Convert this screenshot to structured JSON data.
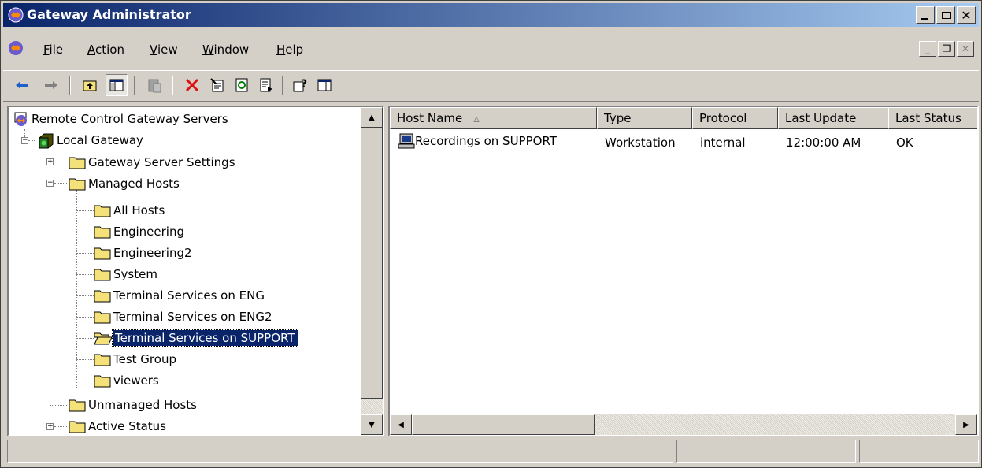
{
  "window": {
    "title": "Gateway Administrator"
  },
  "menu": {
    "items": [
      {
        "label": "File"
      },
      {
        "label": "Action"
      },
      {
        "label": "View"
      },
      {
        "label": "Window"
      },
      {
        "label": "Help"
      }
    ]
  },
  "tree": {
    "root": "Remote Control Gateway Servers",
    "gateway": "Local Gateway",
    "settings": "Gateway Server Settings",
    "managed": "Managed Hosts",
    "groups": [
      "All Hosts",
      "Engineering",
      "Engineering2",
      "System",
      "Terminal Services on ENG",
      "Terminal Services on ENG2",
      "Terminal Services on SUPPORT",
      "Test Group",
      "viewers"
    ],
    "selected_group": "Terminal Services on SUPPORT",
    "unmanaged": "Unmanaged Hosts",
    "active": "Active Status"
  },
  "list": {
    "columns": [
      "Host Name",
      "Type",
      "Protocol",
      "Last Update",
      "Last Status"
    ],
    "sort_indicator": "▵",
    "rows": [
      {
        "host": "Recordings on SUPPORT",
        "type": "Workstation",
        "protocol": "internal",
        "last_update": "12:00:00 AM",
        "last_status": "OK"
      }
    ]
  },
  "colors": {
    "title_start": "#0a246a",
    "title_end": "#a6caf0",
    "selection": "#0a246a",
    "folder": "#f5e17a"
  }
}
